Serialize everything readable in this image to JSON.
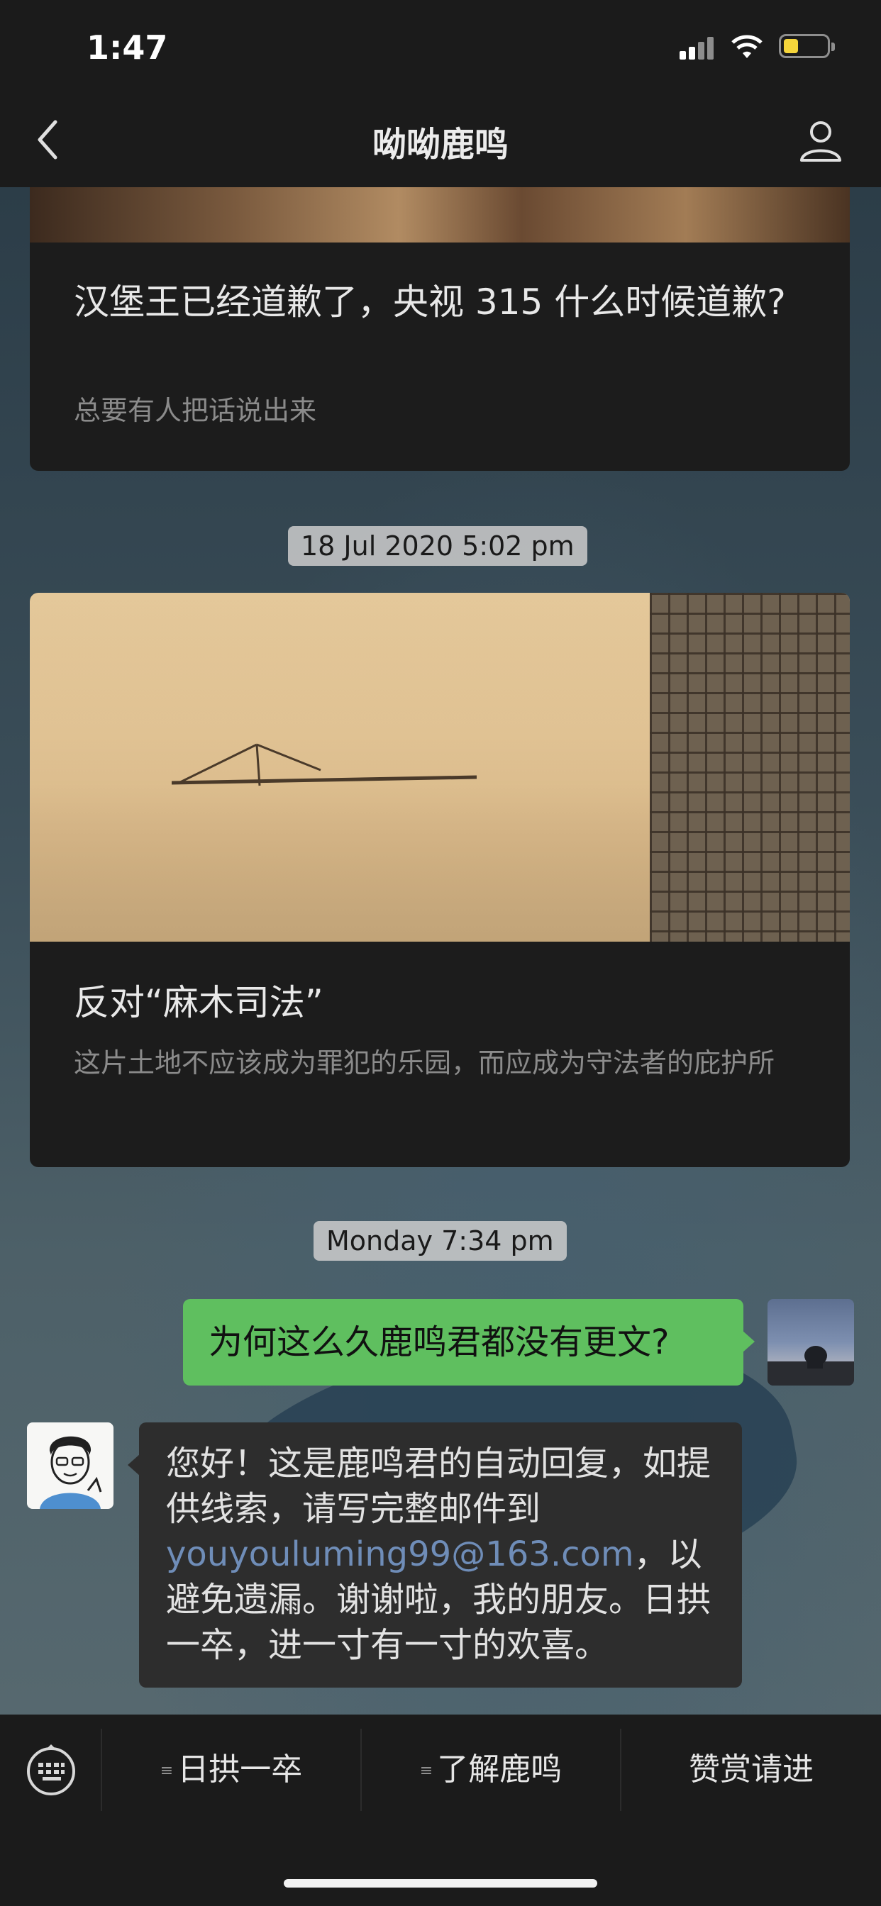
{
  "status_bar": {
    "time": "1:47"
  },
  "header": {
    "title": "呦呦鹿鸣"
  },
  "articles": [
    {
      "title": "汉堡王已经道歉了，央视 315 什么时候道歉?",
      "subtitle": "总要有人把话说出来"
    },
    {
      "timestamp": "18 Jul 2020 5:02 pm",
      "title": "反对“麻木司法”",
      "subtitle": "这片土地不应该成为罪犯的乐园，而应成为守法者的庇护所"
    }
  ],
  "chat": {
    "timestamp": "Monday 7:34 pm",
    "sent_message": "为何这么久鹿鸣君都没有更文?",
    "reply_part1": "您好！这是鹿鸣君的自动回复，如提供线索，请写完整邮件到 ",
    "reply_email": "youyouluming99@163.com",
    "reply_part2": "，以避免遗漏。谢谢啦，我的朋友。日拱一卒，进一寸有一寸的欢喜。"
  },
  "menu": {
    "items": [
      {
        "label": "日拱一卒"
      },
      {
        "label": "了解鹿鸣"
      },
      {
        "label": "赞赏请进"
      }
    ]
  },
  "colors": {
    "header_bg": "#1b1b1b",
    "sent_bubble": "#5fbf5f",
    "received_bubble": "#2d2d2d",
    "link": "#6f8db8",
    "battery": "#f5d53b"
  }
}
